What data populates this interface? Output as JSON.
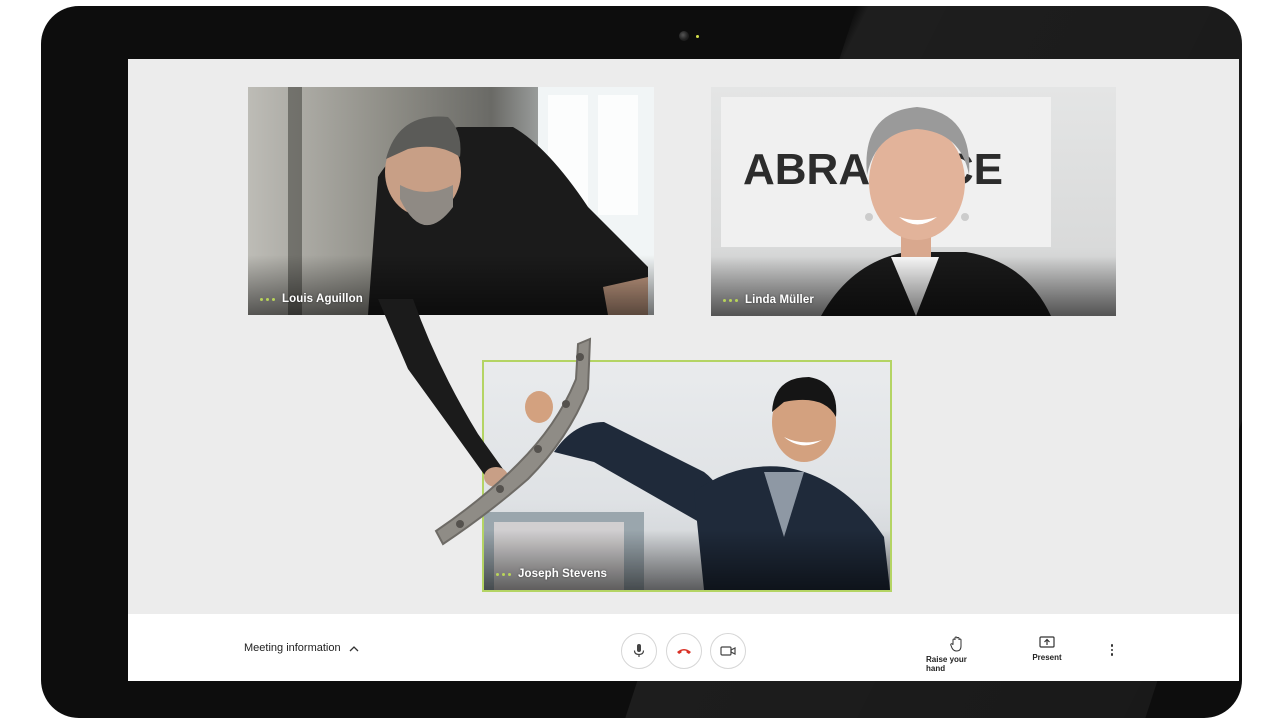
{
  "participants": [
    {
      "name": "Louis Aguillon"
    },
    {
      "name": "Linda Müller"
    },
    {
      "name": "Joseph Stevens"
    }
  ],
  "background_sign_text": "ABRA     ICE",
  "toolbar": {
    "meeting_info_label": "Meeting information",
    "raise_hand_label": "Raise your hand",
    "present_label": "Present"
  },
  "icons": {
    "mic": "microphone-icon",
    "hangup": "phone-hangup-icon",
    "camera": "video-camera-icon",
    "raise_hand": "hand-icon",
    "present": "present-screen-icon",
    "more": "more-vertical-icon",
    "chevron": "chevron-up-icon"
  },
  "colors": {
    "active_speaker_border": "#b4d464",
    "status_dots": "#b8d45a",
    "hangup_red": "#d93025",
    "screen_background": "#ececec"
  }
}
